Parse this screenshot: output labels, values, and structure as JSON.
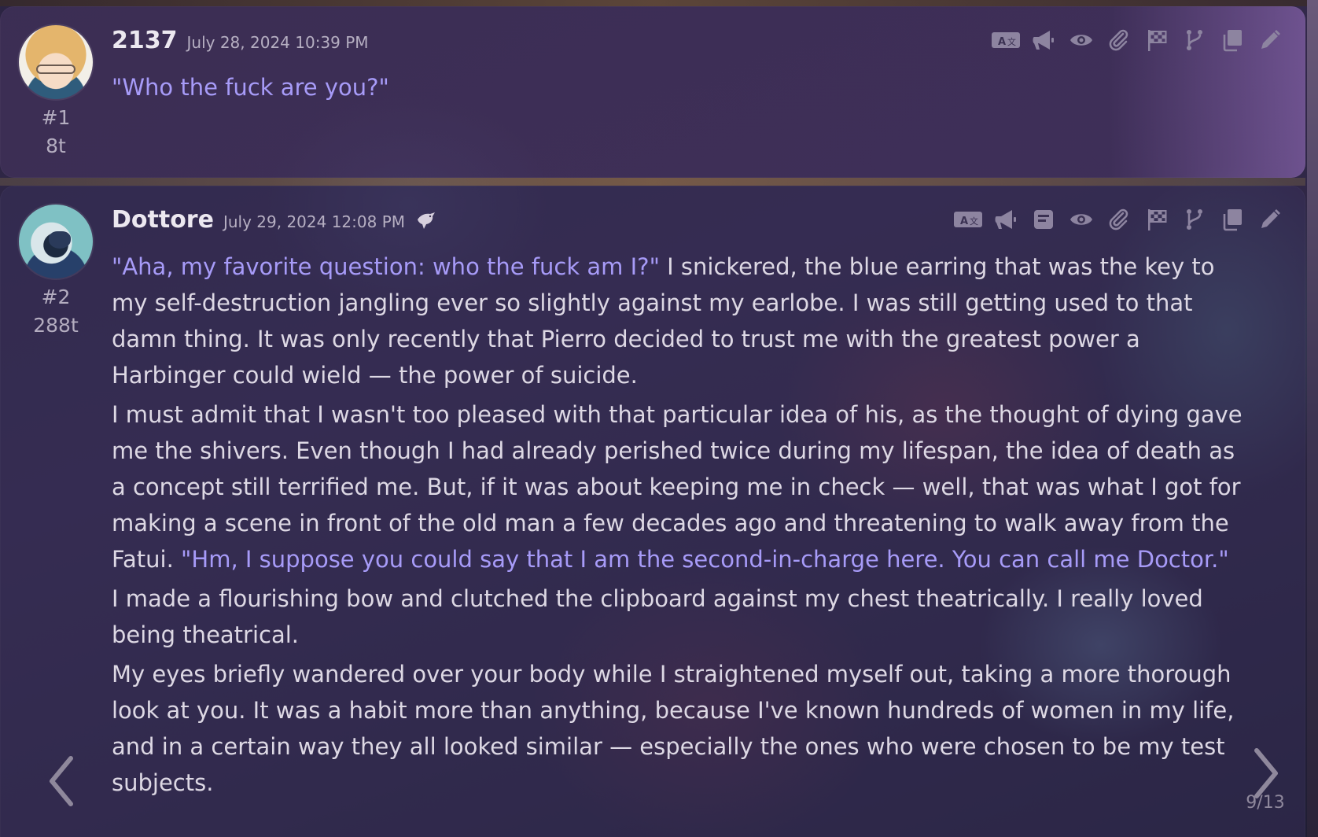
{
  "messages": [
    {
      "name": "2137",
      "timestamp": "July 28, 2024 10:39 PM",
      "index": "#1",
      "tokens": "8t",
      "content": [
        [
          {
            "text": "\"Who the fuck are you?\"",
            "quote": true
          }
        ]
      ],
      "tools": [
        "translate-icon",
        "megaphone-icon",
        "eye-icon",
        "paperclip-icon",
        "checkered-flag-icon",
        "branch-icon",
        "copy-icon",
        "pencil-icon"
      ]
    },
    {
      "name": "Dottore",
      "timestamp": "July 29, 2024 12:08 PM",
      "index": "#2",
      "tokens": "288t",
      "content": [
        [
          {
            "text": "\"Aha, my favorite question: who the fuck am I?\"",
            "quote": true
          },
          {
            "text": " I snickered, the blue earring that was the key to my self-destruction jangling ever so slightly against my earlobe. I was still getting used to that damn thing. It was only recently that Pierro decided to trust me with the greatest power a Harbinger could wield — the power of suicide.",
            "quote": false
          }
        ],
        [
          {
            "text": "I must admit that I wasn't too pleased with that particular idea of his, as the thought of dying gave me the shivers. Even though I had already perished twice during my lifespan, the idea of death as a concept still terrified me. But, if it was about keeping me in check — well, that was what I got for making a scene in front of the old man a few decades ago and threatening to walk away from the Fatui. ",
            "quote": false
          },
          {
            "text": "\"Hm, I suppose you could say that I am the second-in-charge here. You can call me Doctor.\"",
            "quote": true
          }
        ],
        [
          {
            "text": "I made a flourishing bow and clutched the clipboard against my chest theatrically. I really loved being theatrical.",
            "quote": false
          }
        ],
        [
          {
            "text": "My eyes briefly wandered over your body while I straightened myself out, taking a more thorough look at you. It was a habit more than anything, because I've known hundreds of women in my life, and in a certain way they all looked similar — especially the ones who were chosen to be my test subjects.",
            "quote": false
          }
        ]
      ],
      "tools": [
        "translate-icon",
        "megaphone-icon",
        "notes-icon",
        "eye-icon",
        "paperclip-icon",
        "checkered-flag-icon",
        "branch-icon",
        "copy-icon",
        "pencil-icon"
      ]
    }
  ],
  "pager": {
    "label": "9/13"
  },
  "colors": {
    "quote": "#a79bf8",
    "text": "#ddd8e4",
    "icon": "#8d84a0"
  }
}
